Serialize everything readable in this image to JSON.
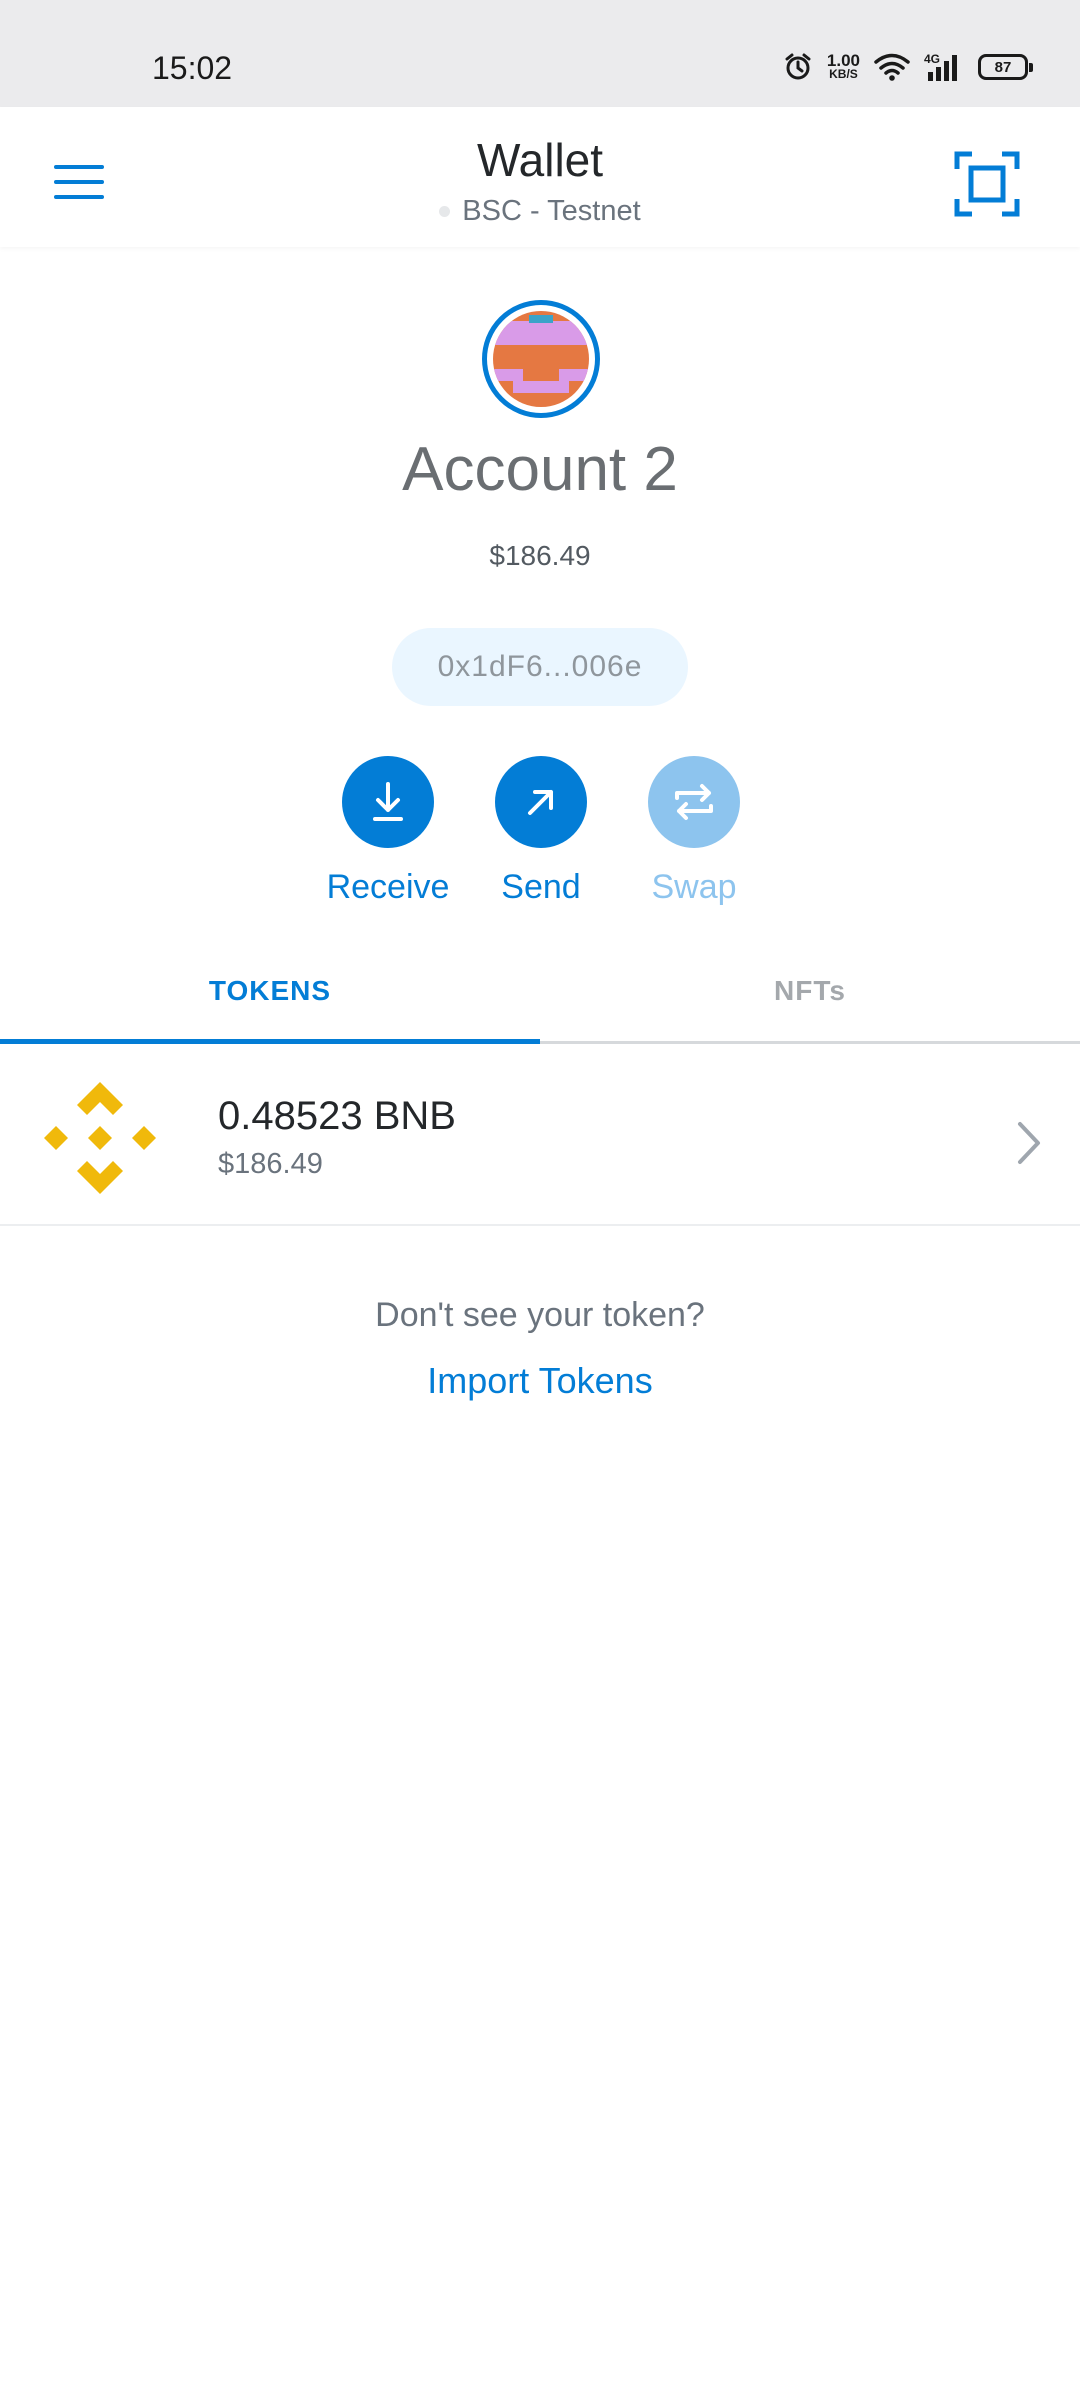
{
  "status_bar": {
    "time": "15:02",
    "net_speed": "1.00",
    "net_speed_unit": "KB/S",
    "network_type": "4G",
    "battery": "87",
    "icons": [
      "alarm-icon",
      "wifi-icon",
      "signal-icon",
      "battery-icon"
    ]
  },
  "header": {
    "title": "Wallet",
    "network": "BSC - Testnet",
    "menu_icon": "hamburger-menu-icon",
    "scan_icon": "qr-scan-icon"
  },
  "account": {
    "name": "Account 2",
    "balance": "$186.49",
    "address": "0x1dF6...006e"
  },
  "actions": [
    {
      "label": "Receive",
      "icon": "receive-icon",
      "enabled": true
    },
    {
      "label": "Send",
      "icon": "send-arrow-icon",
      "enabled": true
    },
    {
      "label": "Swap",
      "icon": "swap-icon",
      "enabled": false
    }
  ],
  "tabs": [
    {
      "label": "TOKENS",
      "active": true
    },
    {
      "label": "NFTs",
      "active": false
    }
  ],
  "tokens": [
    {
      "amount": "0.48523 BNB",
      "fiat": "$186.49",
      "icon": "bnb-logo-icon"
    }
  ],
  "import": {
    "prompt": "Don't see your token?",
    "link": "Import Tokens"
  },
  "colors": {
    "accent": "#037dd6",
    "accent_disabled": "#8dc4ee",
    "bnb_yellow": "#f0b90b"
  }
}
